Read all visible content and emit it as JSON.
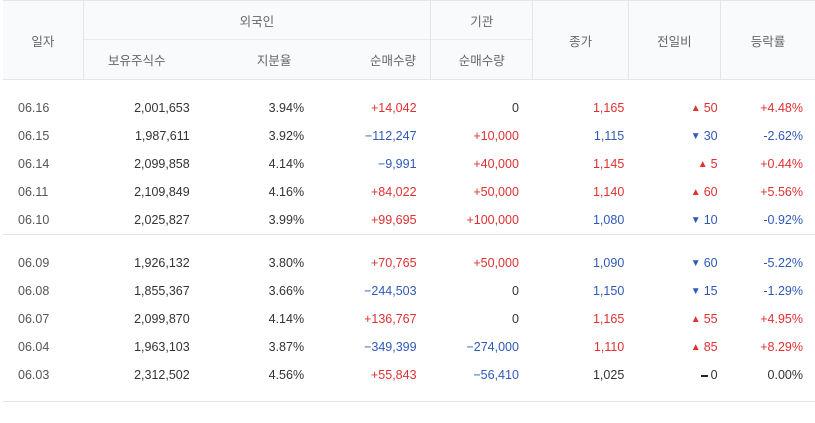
{
  "header": {
    "date": "일자",
    "foreign": "외국인",
    "institution": "기관",
    "close": "종가",
    "change": "전일비",
    "rate": "등락률",
    "holdings": "보유주식수",
    "ratio": "지분율",
    "net_foreign": "순매수량",
    "net_inst": "순매수량"
  },
  "groups": [
    {
      "rows": [
        {
          "date": "06.16",
          "holdings": "2,001,653",
          "ratio": "3.94%",
          "net_foreign": "+14,042",
          "nf_dir": "up",
          "net_inst": "0",
          "ni_dir": "flat",
          "close": "1,165",
          "close_dir": "up",
          "chg_arrow": "▲",
          "chg": "50",
          "chg_dir": "up",
          "rate": "+4.48%",
          "rate_dir": "up"
        },
        {
          "date": "06.15",
          "holdings": "1,987,611",
          "ratio": "3.92%",
          "net_foreign": "−112,247",
          "nf_dir": "down",
          "net_inst": "+10,000",
          "ni_dir": "up",
          "close": "1,115",
          "close_dir": "down",
          "chg_arrow": "▼",
          "chg": "30",
          "chg_dir": "down",
          "rate": "-2.62%",
          "rate_dir": "down"
        },
        {
          "date": "06.14",
          "holdings": "2,099,858",
          "ratio": "4.14%",
          "net_foreign": "−9,991",
          "nf_dir": "down",
          "net_inst": "+40,000",
          "ni_dir": "up",
          "close": "1,145",
          "close_dir": "up",
          "chg_arrow": "▲",
          "chg": "5",
          "chg_dir": "up",
          "rate": "+0.44%",
          "rate_dir": "up"
        },
        {
          "date": "06.11",
          "holdings": "2,109,849",
          "ratio": "4.16%",
          "net_foreign": "+84,022",
          "nf_dir": "up",
          "net_inst": "+50,000",
          "ni_dir": "up",
          "close": "1,140",
          "close_dir": "up",
          "chg_arrow": "▲",
          "chg": "60",
          "chg_dir": "up",
          "rate": "+5.56%",
          "rate_dir": "up"
        },
        {
          "date": "06.10",
          "holdings": "2,025,827",
          "ratio": "3.99%",
          "net_foreign": "+99,695",
          "nf_dir": "up",
          "net_inst": "+100,000",
          "ni_dir": "up",
          "close": "1,080",
          "close_dir": "down",
          "chg_arrow": "▼",
          "chg": "10",
          "chg_dir": "down",
          "rate": "-0.92%",
          "rate_dir": "down"
        }
      ]
    },
    {
      "rows": [
        {
          "date": "06.09",
          "holdings": "1,926,132",
          "ratio": "3.80%",
          "net_foreign": "+70,765",
          "nf_dir": "up",
          "net_inst": "+50,000",
          "ni_dir": "up",
          "close": "1,090",
          "close_dir": "down",
          "chg_arrow": "▼",
          "chg": "60",
          "chg_dir": "down",
          "rate": "-5.22%",
          "rate_dir": "down"
        },
        {
          "date": "06.08",
          "holdings": "1,855,367",
          "ratio": "3.66%",
          "net_foreign": "−244,503",
          "nf_dir": "down",
          "net_inst": "0",
          "ni_dir": "flat",
          "close": "1,150",
          "close_dir": "down",
          "chg_arrow": "▼",
          "chg": "15",
          "chg_dir": "down",
          "rate": "-1.29%",
          "rate_dir": "down"
        },
        {
          "date": "06.07",
          "holdings": "2,099,870",
          "ratio": "4.14%",
          "net_foreign": "+136,767",
          "nf_dir": "up",
          "net_inst": "0",
          "ni_dir": "flat",
          "close": "1,165",
          "close_dir": "up",
          "chg_arrow": "▲",
          "chg": "55",
          "chg_dir": "up",
          "rate": "+4.95%",
          "rate_dir": "up"
        },
        {
          "date": "06.04",
          "holdings": "1,963,103",
          "ratio": "3.87%",
          "net_foreign": "−349,399",
          "nf_dir": "down",
          "net_inst": "−274,000",
          "ni_dir": "down",
          "close": "1,110",
          "close_dir": "up",
          "chg_arrow": "▲",
          "chg": "85",
          "chg_dir": "up",
          "rate": "+8.29%",
          "rate_dir": "up"
        },
        {
          "date": "06.03",
          "holdings": "2,312,502",
          "ratio": "4.56%",
          "net_foreign": "+55,843",
          "nf_dir": "up",
          "net_inst": "−56,410",
          "ni_dir": "down",
          "close": "1,025",
          "close_dir": "flat",
          "chg_arrow": "",
          "chg": "0",
          "chg_dir": "flat",
          "rate": "0.00%",
          "rate_dir": "flat"
        }
      ]
    }
  ],
  "colors": {
    "up": "#e03030",
    "down": "#2f59b7",
    "flat": "#333333"
  }
}
